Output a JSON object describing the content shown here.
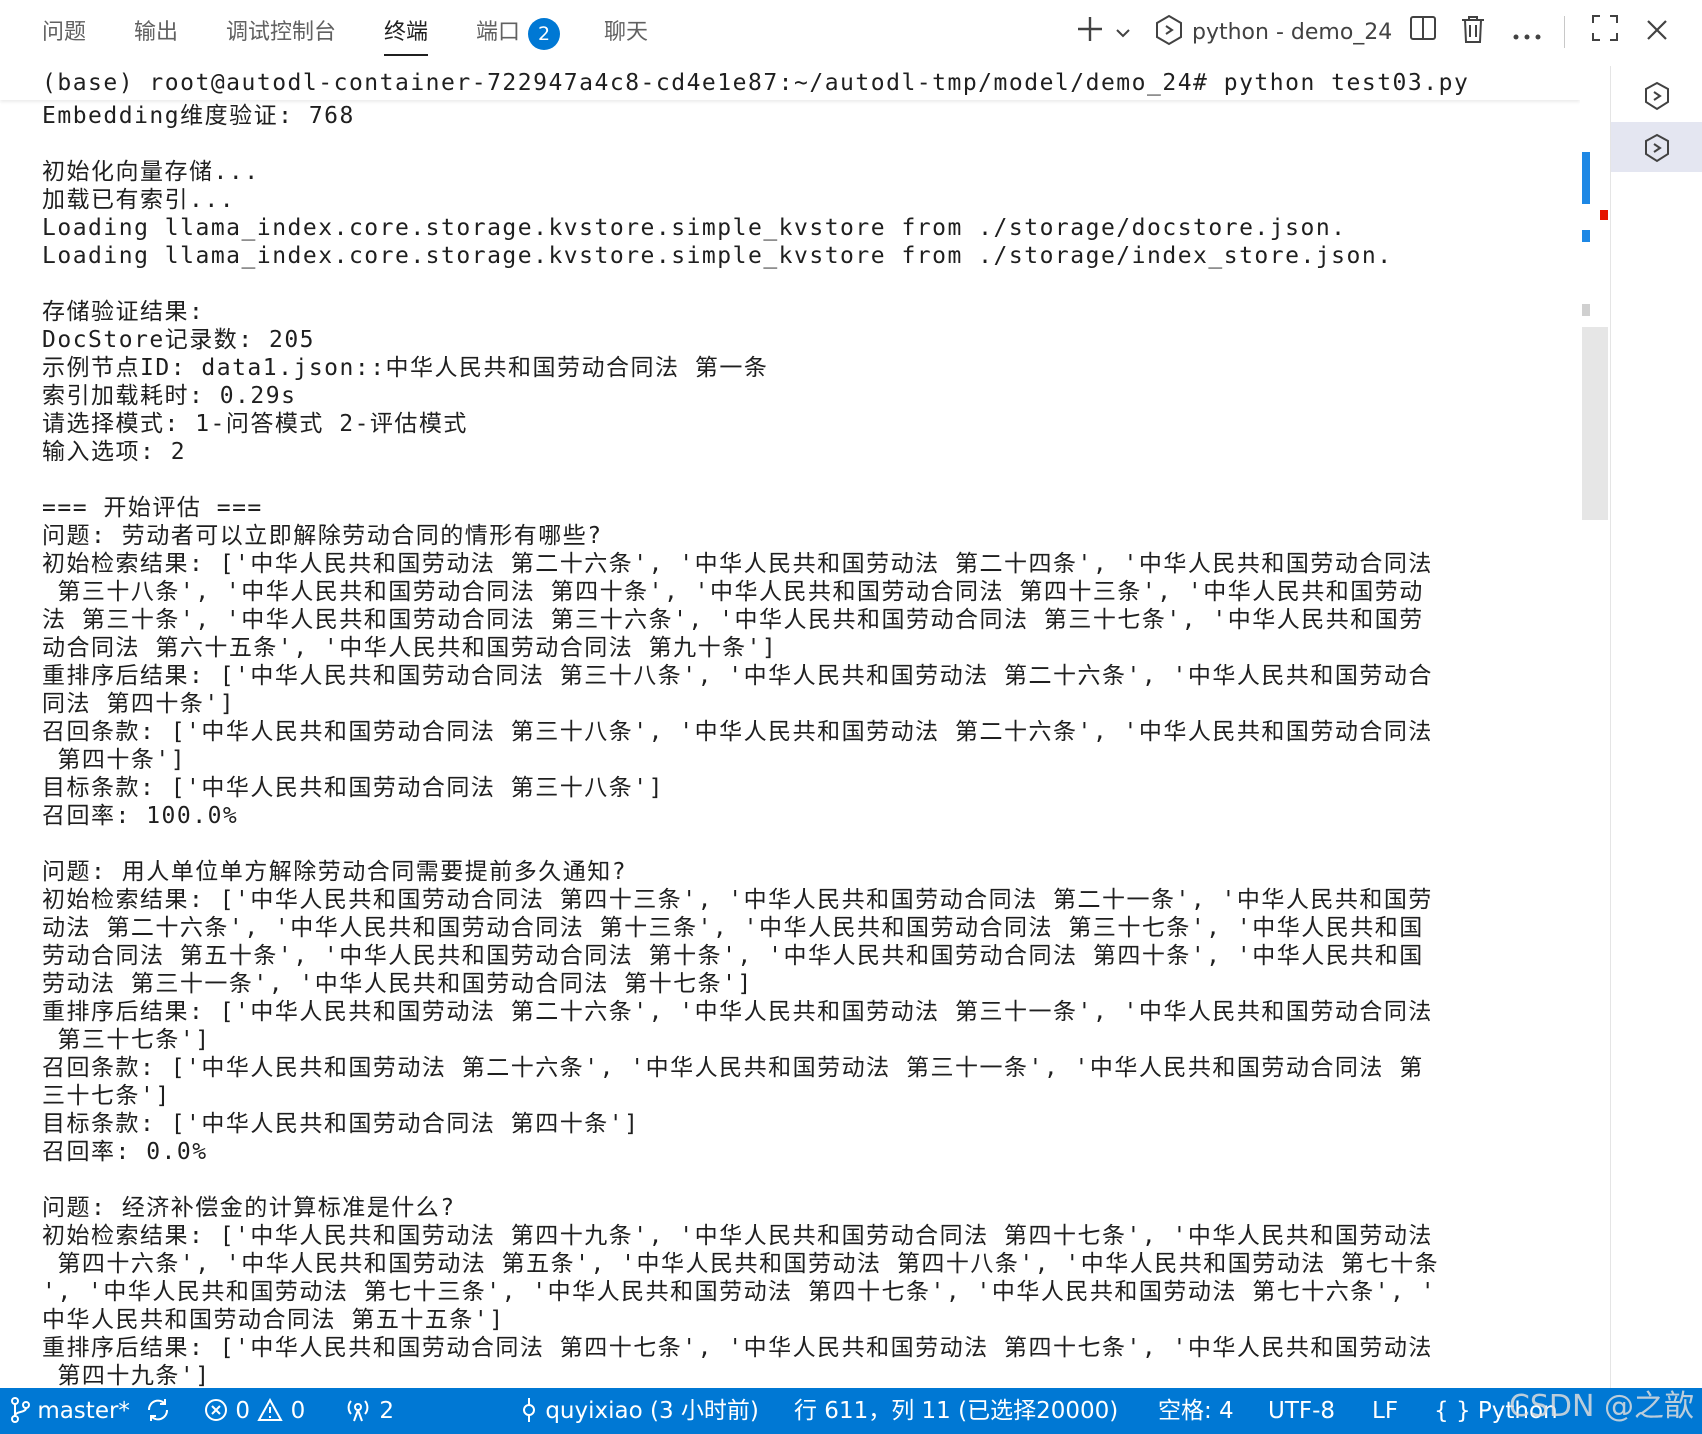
{
  "panel": {
    "tabs": [
      {
        "label": "问题"
      },
      {
        "label": "输出"
      },
      {
        "label": "调试控制台"
      },
      {
        "label": "终端"
      },
      {
        "label": "端口"
      },
      {
        "label": "聊天"
      }
    ],
    "ports_badge": "2",
    "active_tab": "终端",
    "terminal_name": "python - demo_24",
    "icons": [
      "plus-icon",
      "chevron-down-icon",
      "terminal-shell-icon",
      "split-icon",
      "trash-icon",
      "more-icon",
      "maximize-icon",
      "close-icon"
    ]
  },
  "terminal": {
    "command_line": "(base) root@autodl-container-722947a4c8-cd4e1e87:~/autodl-tmp/model/demo_24# python test03.py",
    "output": "Embedding维度验证: 768\n\n初始化向量存储...\n加载已有索引...\nLoading llama_index.core.storage.kvstore.simple_kvstore from ./storage/docstore.json.\nLoading llama_index.core.storage.kvstore.simple_kvstore from ./storage/index_store.json.\n\n存储验证结果:\nDocStore记录数: 205\n示例节点ID: data1.json::中华人民共和国劳动合同法 第一条\n索引加载耗时: 0.29s\n请选择模式: 1-问答模式 2-评估模式\n输入选项: 2\n\n=== 开始评估 ===\n问题: 劳动者可以立即解除劳动合同的情形有哪些?\n初始检索结果: ['中华人民共和国劳动法 第二十六条', '中华人民共和国劳动法 第二十四条', '中华人民共和国劳动合同法\n 第三十八条', '中华人民共和国劳动合同法 第四十条', '中华人民共和国劳动合同法 第四十三条', '中华人民共和国劳动\n法 第三十条', '中华人民共和国劳动合同法 第三十六条', '中华人民共和国劳动合同法 第三十七条', '中华人民共和国劳\n动合同法 第六十五条', '中华人民共和国劳动合同法 第九十条']\n重排序后结果: ['中华人民共和国劳动合同法 第三十八条', '中华人民共和国劳动法 第二十六条', '中华人民共和国劳动合\n同法 第四十条']\n召回条款: ['中华人民共和国劳动合同法 第三十八条', '中华人民共和国劳动法 第二十六条', '中华人民共和国劳动合同法\n 第四十条']\n目标条款: ['中华人民共和国劳动合同法 第三十八条']\n召回率: 100.0%\n\n问题: 用人单位单方解除劳动合同需要提前多久通知?\n初始检索结果: ['中华人民共和国劳动合同法 第四十三条', '中华人民共和国劳动合同法 第二十一条', '中华人民共和国劳\n动法 第二十六条', '中华人民共和国劳动合同法 第十三条', '中华人民共和国劳动合同法 第三十七条', '中华人民共和国\n劳动合同法 第五十条', '中华人民共和国劳动合同法 第十条', '中华人民共和国劳动合同法 第四十条', '中华人民共和国\n劳动法 第三十一条', '中华人民共和国劳动合同法 第十七条']\n重排序后结果: ['中华人民共和国劳动法 第二十六条', '中华人民共和国劳动法 第三十一条', '中华人民共和国劳动合同法\n 第三十七条']\n召回条款: ['中华人民共和国劳动法 第二十六条', '中华人民共和国劳动法 第三十一条', '中华人民共和国劳动合同法 第\n三十七条']\n目标条款: ['中华人民共和国劳动合同法 第四十条']\n召回率: 0.0%\n\n问题: 经济补偿金的计算标准是什么?\n初始检索结果: ['中华人民共和国劳动法 第四十九条', '中华人民共和国劳动合同法 第四十七条', '中华人民共和国劳动法\n 第四十六条', '中华人民共和国劳动法 第五条', '中华人民共和国劳动法 第四十八条', '中华人民共和国劳动法 第七十条\n', '中华人民共和国劳动法 第七十三条', '中华人民共和国劳动法 第四十七条', '中华人民共和国劳动法 第七十六条', '\n中华人民共和国劳动合同法 第五十五条']\n重排序后结果: ['中华人民共和国劳动合同法 第四十七条', '中华人民共和国劳动法 第四十七条', '中华人民共和国劳动法\n 第四十九条']"
  },
  "status_bar": {
    "branch": "master*",
    "errors": "0",
    "warnings": "0",
    "ports": "2",
    "blame": "quyixiao (3 小时前)",
    "cursor": "行 611，列 11 (已选择20000)",
    "indent": "空格: 4",
    "encoding": "UTF-8",
    "eol": "LF",
    "language": "{ } Python",
    "watermark": "CSDN @之歆"
  },
  "colors": {
    "accent": "#0078d4",
    "scroll_marker_blue": "#1e88e5",
    "scroll_marker_red": "#e51400"
  }
}
